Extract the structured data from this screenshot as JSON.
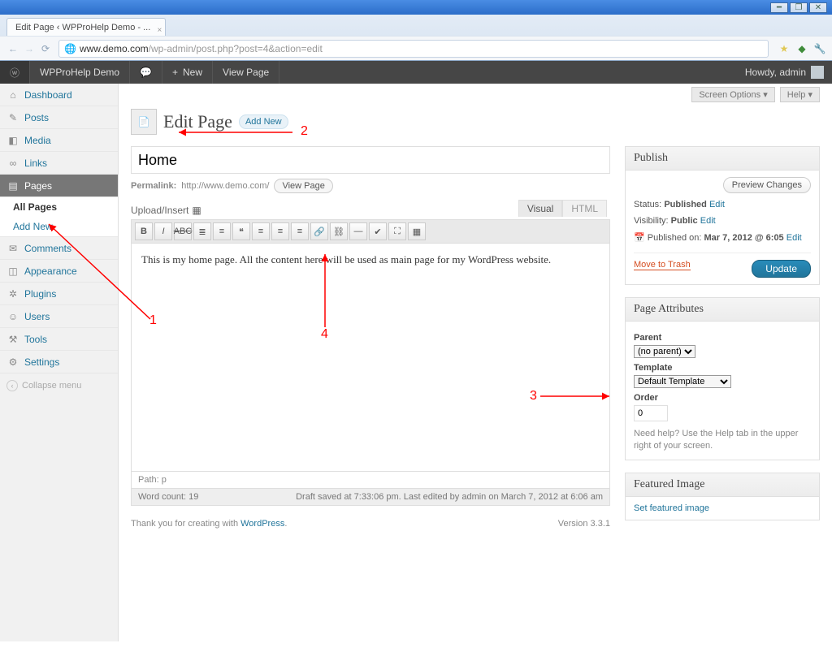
{
  "browser": {
    "tab_title": "Edit Page ‹ WPProHelp Demo - ...",
    "url_main": "www.demo.com",
    "url_path": "/wp-admin/post.php?post=4&action=edit"
  },
  "adminbar": {
    "site_name": "WPProHelp Demo",
    "new_label": "New",
    "view_label": "View Page",
    "howdy": "Howdy, admin"
  },
  "sidebar": {
    "items": [
      {
        "label": "Dashboard",
        "icon": "⌂"
      },
      {
        "label": "Posts",
        "icon": "✎"
      },
      {
        "label": "Media",
        "icon": "◧"
      },
      {
        "label": "Links",
        "icon": "∞"
      },
      {
        "label": "Pages",
        "icon": "▤",
        "current": true
      },
      {
        "label": "Comments",
        "icon": "✉"
      },
      {
        "label": "Appearance",
        "icon": "◫"
      },
      {
        "label": "Plugins",
        "icon": "✲"
      },
      {
        "label": "Users",
        "icon": "☺"
      },
      {
        "label": "Tools",
        "icon": "⚒"
      },
      {
        "label": "Settings",
        "icon": "⚙"
      }
    ],
    "sub": {
      "all": "All Pages",
      "addnew": "Add New"
    },
    "collapse": "Collapse menu"
  },
  "screen_options": "Screen Options",
  "help_label": "Help",
  "heading": "Edit Page",
  "addnew_btn": "Add New",
  "title_value": "Home",
  "permalink_label": "Permalink:",
  "permalink_url": "http://www.demo.com/",
  "viewpage_btn": "View Page",
  "upload_label": "Upload/Insert",
  "tabs": {
    "visual": "Visual",
    "html": "HTML"
  },
  "content": "This is my home page. All the content here will be used as main page for my WordPress website.",
  "path_label": "Path:",
  "path_value": "p",
  "wordcount_label": "Word count:",
  "wordcount": "19",
  "draft_status": "Draft saved at 7:33:06 pm. Last edited by admin on March 7, 2012 at 6:06 am",
  "publish": {
    "heading": "Publish",
    "preview": "Preview Changes",
    "status_label": "Status:",
    "status_value": "Published",
    "visibility_label": "Visibility:",
    "visibility_value": "Public",
    "published_label": "Published on:",
    "published_value": "Mar 7, 2012 @ 6:05",
    "edit": "Edit",
    "trash": "Move to Trash",
    "update": "Update"
  },
  "attrs": {
    "heading": "Page Attributes",
    "parent_label": "Parent",
    "parent_value": "(no parent)",
    "template_label": "Template",
    "template_value": "Default Template",
    "order_label": "Order",
    "order_value": "0",
    "help": "Need help? Use the Help tab in the upper right of your screen."
  },
  "featured": {
    "heading": "Featured Image",
    "link": "Set featured image"
  },
  "footer": {
    "thank": "Thank you for creating with ",
    "wp": "WordPress",
    "version": "Version 3.3.1"
  },
  "annotations": {
    "n1": "1",
    "n2": "2",
    "n3": "3",
    "n4": "4"
  }
}
